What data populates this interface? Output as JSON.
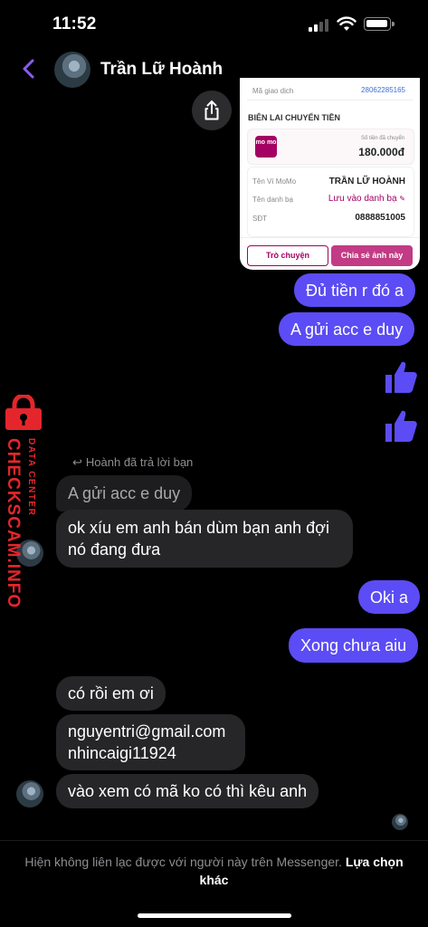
{
  "status_bar": {
    "time": "11:52"
  },
  "header": {
    "contact_name": "Trần Lữ Hoành"
  },
  "receipt": {
    "ref_label": "Mã giao dịch",
    "ref_value": "28062285165",
    "heading": "BIÊN LAI CHUYỂN TIỀN",
    "logo_text": "mo mo",
    "amount_label": "Số tiền đã chuyển",
    "amount": "180.000đ",
    "wallet_label": "Tên Ví MoMo",
    "wallet_value": "TRẦN LỮ HOÀNH",
    "contacts_label": "Tên danh bạ",
    "contacts_value": "Lưu vào danh bạ",
    "phone_label": "SĐT",
    "phone_value": "0888851005",
    "chat_button": "Trò chuyện",
    "share_button": "Chia sẻ ảnh này"
  },
  "messages": {
    "m1": "Đủ tiền r đó a",
    "m2": "A gửi acc e duy",
    "reply_note": "Hoành đã trả lời bạn",
    "quoted": "A gửi acc e duy",
    "m3_line1": "ok xíu em anh bán dùm bạn anh đợi",
    "m3_line2": "nó đang đưa",
    "m4": "Oki a",
    "m5": "Xong chưa aiu",
    "m6": "có rồi em ơi",
    "m7_line1": "nguyentri@gmail.com",
    "m7_line2": "nhincaigi11924",
    "m8": "vào xem có mã ko có thì kêu anh"
  },
  "watermark": {
    "line1": "DATA CENTER",
    "line2": "CHECKSCAM.INFO"
  },
  "footer": {
    "text": "Hiện không liên lạc được với người này trên Messenger.",
    "link": "Lựa chọn khác"
  },
  "colors": {
    "outgoing": "#5b4cf5",
    "incoming": "#262628",
    "accent": "#8b5cf6",
    "momo": "#a50064",
    "watermark": "#e4262c"
  }
}
